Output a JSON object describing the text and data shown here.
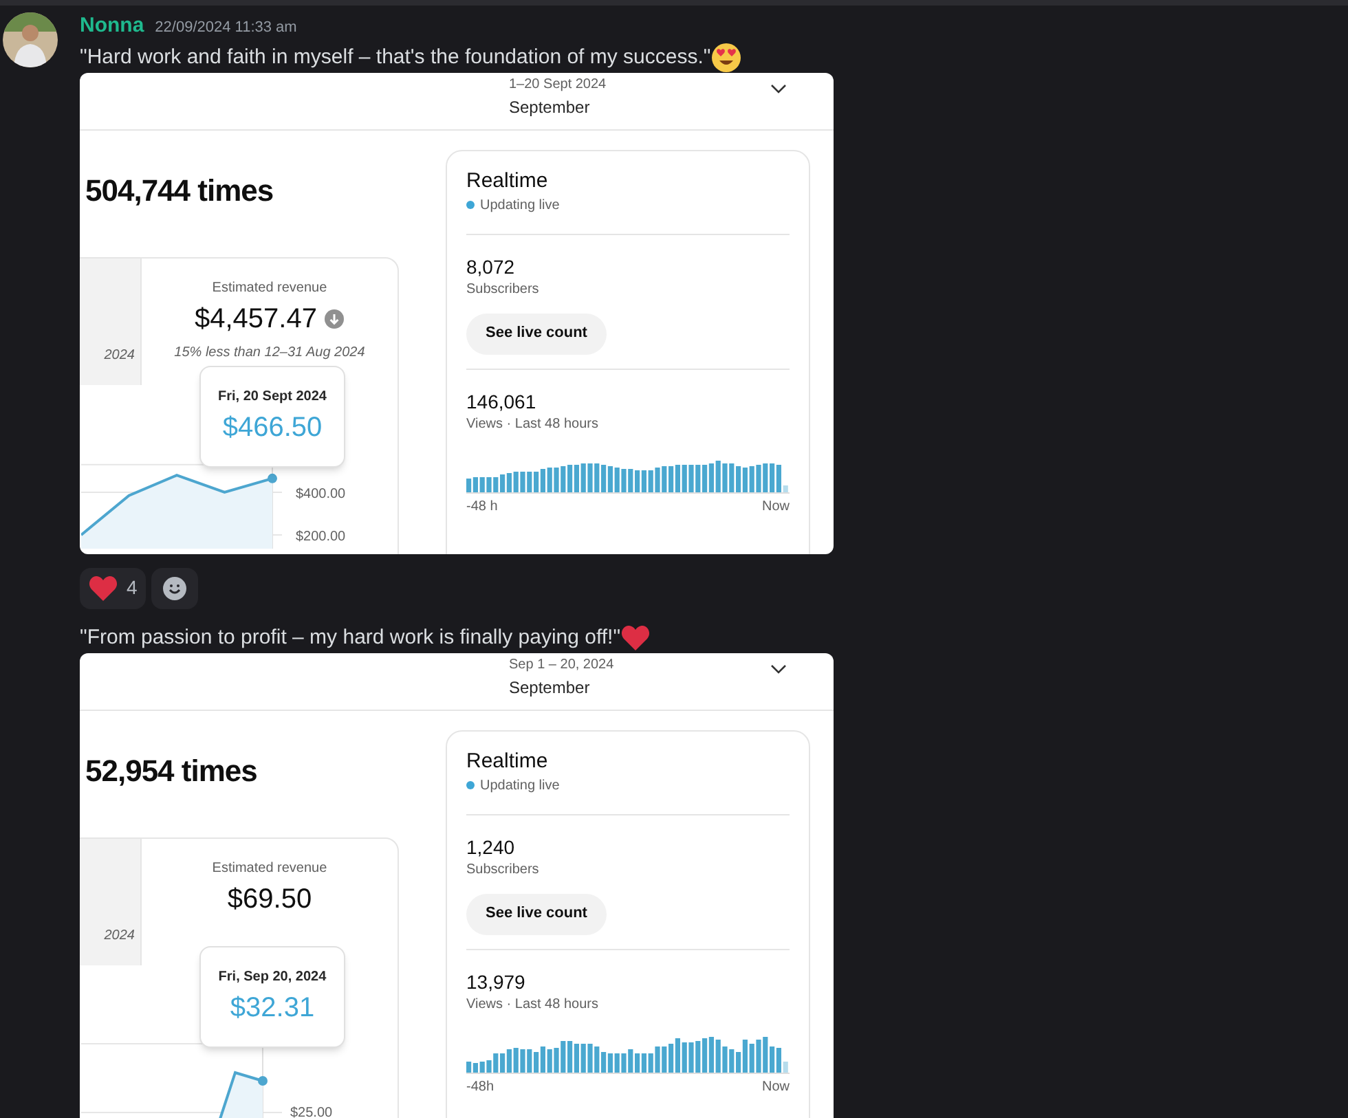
{
  "message": {
    "author": "Nonna",
    "timestamp": "22/09/2024 11:33 am"
  },
  "posts": [
    {
      "text": "\"Hard work and faith in myself – that's the foundation of my success.\"",
      "emoji": {
        "kind": "heart_eyes"
      },
      "screenshot": {
        "date_range": "1–20 Sept 2024",
        "period": "September",
        "headline": "504,744 times",
        "revenue": {
          "fragment": "2024",
          "label": "Estimated revenue",
          "amount": "$4,457.47",
          "decreased": true,
          "comparison": "15% less than 12–31 Aug 2024"
        },
        "tooltip": {
          "date": "Fri, 20 Sept 2024",
          "value": "$466.50"
        },
        "chart_data": {
          "type": "area",
          "ylim": [
            130,
            530
          ],
          "yticks": [
            {
              "value": 400,
              "label": "$400.00"
            },
            {
              "value": 200,
              "label": "$200.00"
            }
          ],
          "series": [
            {
              "color": "#4da6cf",
              "values": [
                200,
                385,
                480,
                400,
                465
              ]
            }
          ]
        },
        "realtime": {
          "title": "Realtime",
          "status": "Updating live",
          "subscribers": "8,072",
          "subscribers_label": "Subscribers",
          "button": "See live count",
          "views": "146,061",
          "views_label": "Views · Last 48 hours",
          "x_start": "-48 h",
          "x_end": "Now"
        }
      },
      "reactions": [
        {
          "kind": "heart",
          "count": "4"
        },
        {
          "kind": "add"
        }
      ]
    },
    {
      "text": "\"From passion to profit – my hard work is finally paying off!\"",
      "emoji": {
        "kind": "heart"
      },
      "screenshot": {
        "date_range": "Sep 1 – 20, 2024",
        "period": "September",
        "headline": "52,954 times",
        "revenue": {
          "fragment": "2024",
          "label": "Estimated revenue",
          "amount": "$69.50",
          "decreased": false
        },
        "tooltip": {
          "date": "Fri, Sep 20, 2024",
          "value": "$32.31"
        },
        "tick": "$25.00",
        "realtime": {
          "title": "Realtime",
          "status": "Updating live",
          "subscribers": "1,240",
          "subscribers_label": "Subscribers",
          "button": "See live count",
          "views": "13,979",
          "views_label": "Views · Last 48 hours",
          "x_start": "-48h",
          "x_end": "Now"
        }
      }
    }
  ]
}
